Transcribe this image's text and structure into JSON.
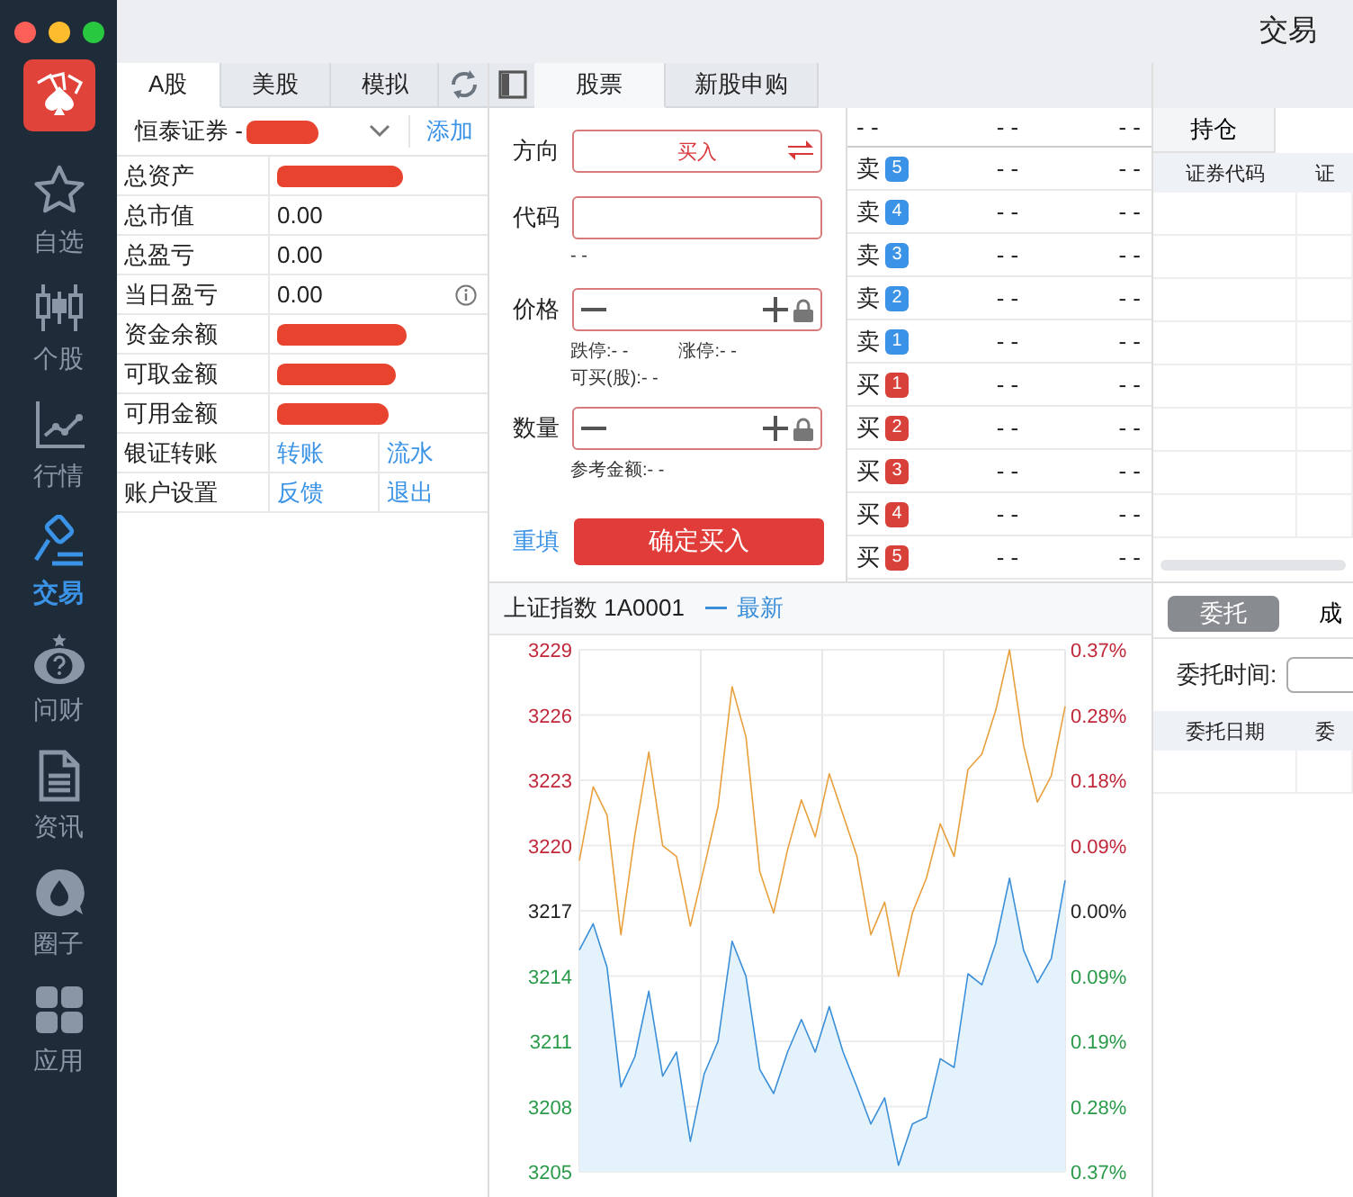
{
  "window": {
    "title": "交易"
  },
  "sidebar": {
    "items": [
      {
        "label": "自选",
        "selected": false
      },
      {
        "label": "个股",
        "selected": false
      },
      {
        "label": "行情",
        "selected": false
      },
      {
        "label": "交易",
        "selected": true
      },
      {
        "label": "问财",
        "selected": false
      },
      {
        "label": "资讯",
        "selected": false
      },
      {
        "label": "圈子",
        "selected": false
      },
      {
        "label": "应用",
        "selected": false
      }
    ]
  },
  "account_tabs": [
    {
      "label": "A股",
      "selected": true
    },
    {
      "label": "美股",
      "selected": false
    },
    {
      "label": "模拟",
      "selected": false
    }
  ],
  "broker": {
    "name": "恒泰证券 -",
    "redacted": true,
    "action": "添加"
  },
  "account_rows": [
    {
      "kind": "value",
      "label": "总资产",
      "redacted": true,
      "info": false
    },
    {
      "kind": "value",
      "label": "总市值",
      "value": "0.00",
      "redacted": false,
      "info": false
    },
    {
      "kind": "value",
      "label": "总盈亏",
      "value": "0.00",
      "redacted": false,
      "info": false
    },
    {
      "kind": "value",
      "label": "当日盈亏",
      "value": "0.00",
      "redacted": false,
      "info": true
    },
    {
      "kind": "value",
      "label": "资金余额",
      "redacted": true,
      "info": false
    },
    {
      "kind": "value",
      "label": "可取金额",
      "redacted": true,
      "info": false
    },
    {
      "kind": "value",
      "label": "可用金额",
      "redacted": true,
      "info": false
    },
    {
      "kind": "links",
      "label": "银证转账",
      "links": [
        "转账",
        "流水"
      ]
    },
    {
      "kind": "links",
      "label": "账户设置",
      "links": [
        "反馈",
        "退出"
      ]
    }
  ],
  "trade_tabs": [
    {
      "label": "股票",
      "selected": true
    },
    {
      "label": "新股申购",
      "selected": false
    }
  ],
  "order_form": {
    "fields": [
      {
        "kind": "direction",
        "label": "方向",
        "value": "买入"
      },
      {
        "kind": "text",
        "label": "代码",
        "notes": [
          [
            "- -"
          ]
        ]
      },
      {
        "kind": "stepper",
        "label": "价格",
        "notes": [
          [
            "跌停:- -",
            "涨停:- -"
          ],
          [
            "可买(股):- -"
          ]
        ]
      },
      {
        "kind": "stepper",
        "label": "数量",
        "notes": [
          [
            "参考金额:- -"
          ]
        ]
      }
    ],
    "reset": "重填",
    "submit": "确定买入"
  },
  "order_book": {
    "header": [
      "- -",
      "- -",
      "- -"
    ],
    "rows": [
      {
        "kind": "sell",
        "side": "卖",
        "rank": "5",
        "price": "- -",
        "volume": "- -"
      },
      {
        "kind": "sell",
        "side": "卖",
        "rank": "4",
        "price": "- -",
        "volume": "- -"
      },
      {
        "kind": "sell",
        "side": "卖",
        "rank": "3",
        "price": "- -",
        "volume": "- -"
      },
      {
        "kind": "sell",
        "side": "卖",
        "rank": "2",
        "price": "- -",
        "volume": "- -"
      },
      {
        "kind": "sell",
        "side": "卖",
        "rank": "1",
        "price": "- -",
        "volume": "- -"
      },
      {
        "kind": "buy",
        "side": "买",
        "rank": "1",
        "price": "- -",
        "volume": "- -"
      },
      {
        "kind": "buy",
        "side": "买",
        "rank": "2",
        "price": "- -",
        "volume": "- -"
      },
      {
        "kind": "buy",
        "side": "买",
        "rank": "3",
        "price": "- -",
        "volume": "- -"
      },
      {
        "kind": "buy",
        "side": "买",
        "rank": "4",
        "price": "- -",
        "volume": "- -"
      },
      {
        "kind": "buy",
        "side": "买",
        "rank": "5",
        "price": "- -",
        "volume": "- -"
      }
    ]
  },
  "positions": {
    "tab": {
      "label": "持仓",
      "selected": true
    },
    "columns": [
      "证券代码",
      "证"
    ]
  },
  "orders": {
    "segments": [
      {
        "label": "委托",
        "selected": true
      },
      {
        "label": "成",
        "selected": false
      }
    ],
    "time_label": "委托时间:",
    "columns": [
      "委托日期",
      "委"
    ]
  },
  "chart": {
    "title": "上证指数 1A0001",
    "chart_data": {
      "type": "line",
      "categories": [
        null,
        null,
        null,
        null,
        null,
        null,
        null,
        null,
        null,
        null,
        null,
        null,
        null,
        null,
        null,
        null,
        null,
        null,
        null,
        null,
        null,
        null,
        null,
        null,
        null,
        null,
        null,
        null,
        null,
        null,
        null,
        null,
        null,
        null,
        null,
        null
      ],
      "ylim": [
        3205,
        3229
      ],
      "yticks": [
        3205,
        3208,
        3211,
        3214,
        3217,
        3220,
        3223,
        3226,
        3229
      ],
      "grid": true,
      "annotations": [
        "0.37%",
        "0.28%",
        "0.19%",
        "0.09%",
        "0.00%",
        "0.09%",
        "0.18%",
        "0.28%",
        "0.37%"
      ],
      "series": [
        {
          "type": "line",
          "color": "#e8a03c",
          "values": [
            3219.3,
            3222.7,
            3221.4,
            3215.9,
            3220.5,
            3224.3,
            3220,
            3219.5,
            3216.3,
            3219,
            3221.8,
            3227.3,
            3225,
            3218.8,
            3216.9,
            3219.8,
            3222.1,
            3220.4,
            3223.3,
            3221.4,
            3219.5,
            3215.9,
            3217.4,
            3214,
            3216.9,
            3218.5,
            3221,
            3219.5,
            3223.5,
            3224.2,
            3226.2,
            3229,
            3224.6,
            3222,
            3223.2,
            3226.4
          ]
        },
        {
          "type": "area",
          "name": "最新",
          "color": "#3a8fd8",
          "values": [
            3215.2,
            3216.4,
            3214.4,
            3208.9,
            3210.3,
            3213.3,
            3209.4,
            3210.5,
            3206.4,
            3209.5,
            3211,
            3215.6,
            3214,
            3209.7,
            3208.6,
            3210.5,
            3212,
            3210.5,
            3212.6,
            3210.5,
            3208.9,
            3207.2,
            3208.4,
            3205.3,
            3207.2,
            3207.5,
            3210.2,
            3209.8,
            3214.1,
            3213.6,
            3215.5,
            3218.5,
            3215.2,
            3213.7,
            3214.8,
            3218.4
          ]
        }
      ]
    }
  }
}
